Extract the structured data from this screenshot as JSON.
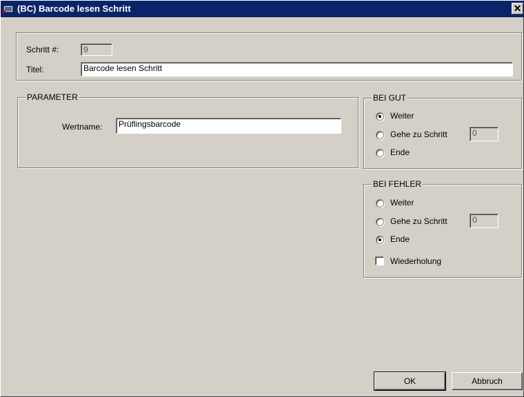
{
  "window": {
    "title": "(BC) Barcode lesen Schritt",
    "close_glyph": "✕"
  },
  "header": {
    "step_label": "Schritt #:",
    "step_value": "9",
    "title_label": "Titel:",
    "title_value": "Barcode lesen Schritt"
  },
  "parameter": {
    "legend": "PARAMETER",
    "wertname_label": "Wertname:",
    "wertname_value": "Prüflingsbarcode"
  },
  "bei_gut": {
    "legend": "BEI GUT",
    "options": [
      "Weiter",
      "Gehe zu Schritt",
      "Ende"
    ],
    "selected": "Weiter",
    "step_value": "0"
  },
  "bei_fehler": {
    "legend": "BEI FEHLER",
    "options": [
      "Weiter",
      "Gehe zu Schritt",
      "Ende"
    ],
    "selected": "Ende",
    "step_value": "0",
    "repeat_label": "Wiederholung",
    "repeat_checked": false
  },
  "buttons": {
    "ok": "OK",
    "cancel": "Abbruch"
  },
  "colors": {
    "titlebar": "#0a246a",
    "face": "#d4d0c8"
  }
}
